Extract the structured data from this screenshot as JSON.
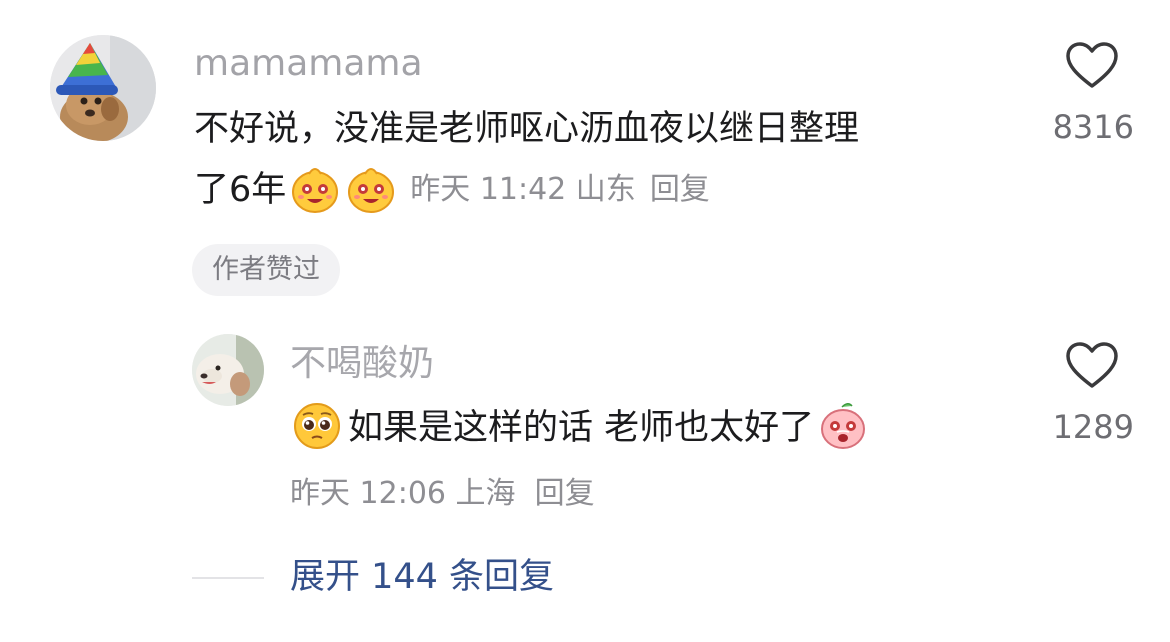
{
  "main_comment": {
    "username": "mamamama",
    "text_line1": "不好说，没准是老师呕心沥血夜以继日整理",
    "text_line2": "了6年",
    "emojis": [
      "smiling-face-emoji",
      "smiling-face-emoji"
    ],
    "meta": "昨天 11:42 山东",
    "reply_label": "回复",
    "likes": "8316",
    "badge": "作者赞过"
  },
  "reply_comment": {
    "username": "不喝酸奶",
    "emoji_before": "pleading-face-emoji",
    "text": "如果是这样的话 老师也太好了",
    "emoji_after": "peach-crying-emoji",
    "meta": "昨天 12:06 上海",
    "reply_label": "回复",
    "likes": "1289"
  },
  "expand": {
    "label": "展开 144 条回复"
  },
  "colors": {
    "text": "#1c1c1e",
    "username": "#a3a3a8",
    "meta": "#8e8e93",
    "link": "#34508a",
    "badge_bg": "#f2f2f4"
  }
}
